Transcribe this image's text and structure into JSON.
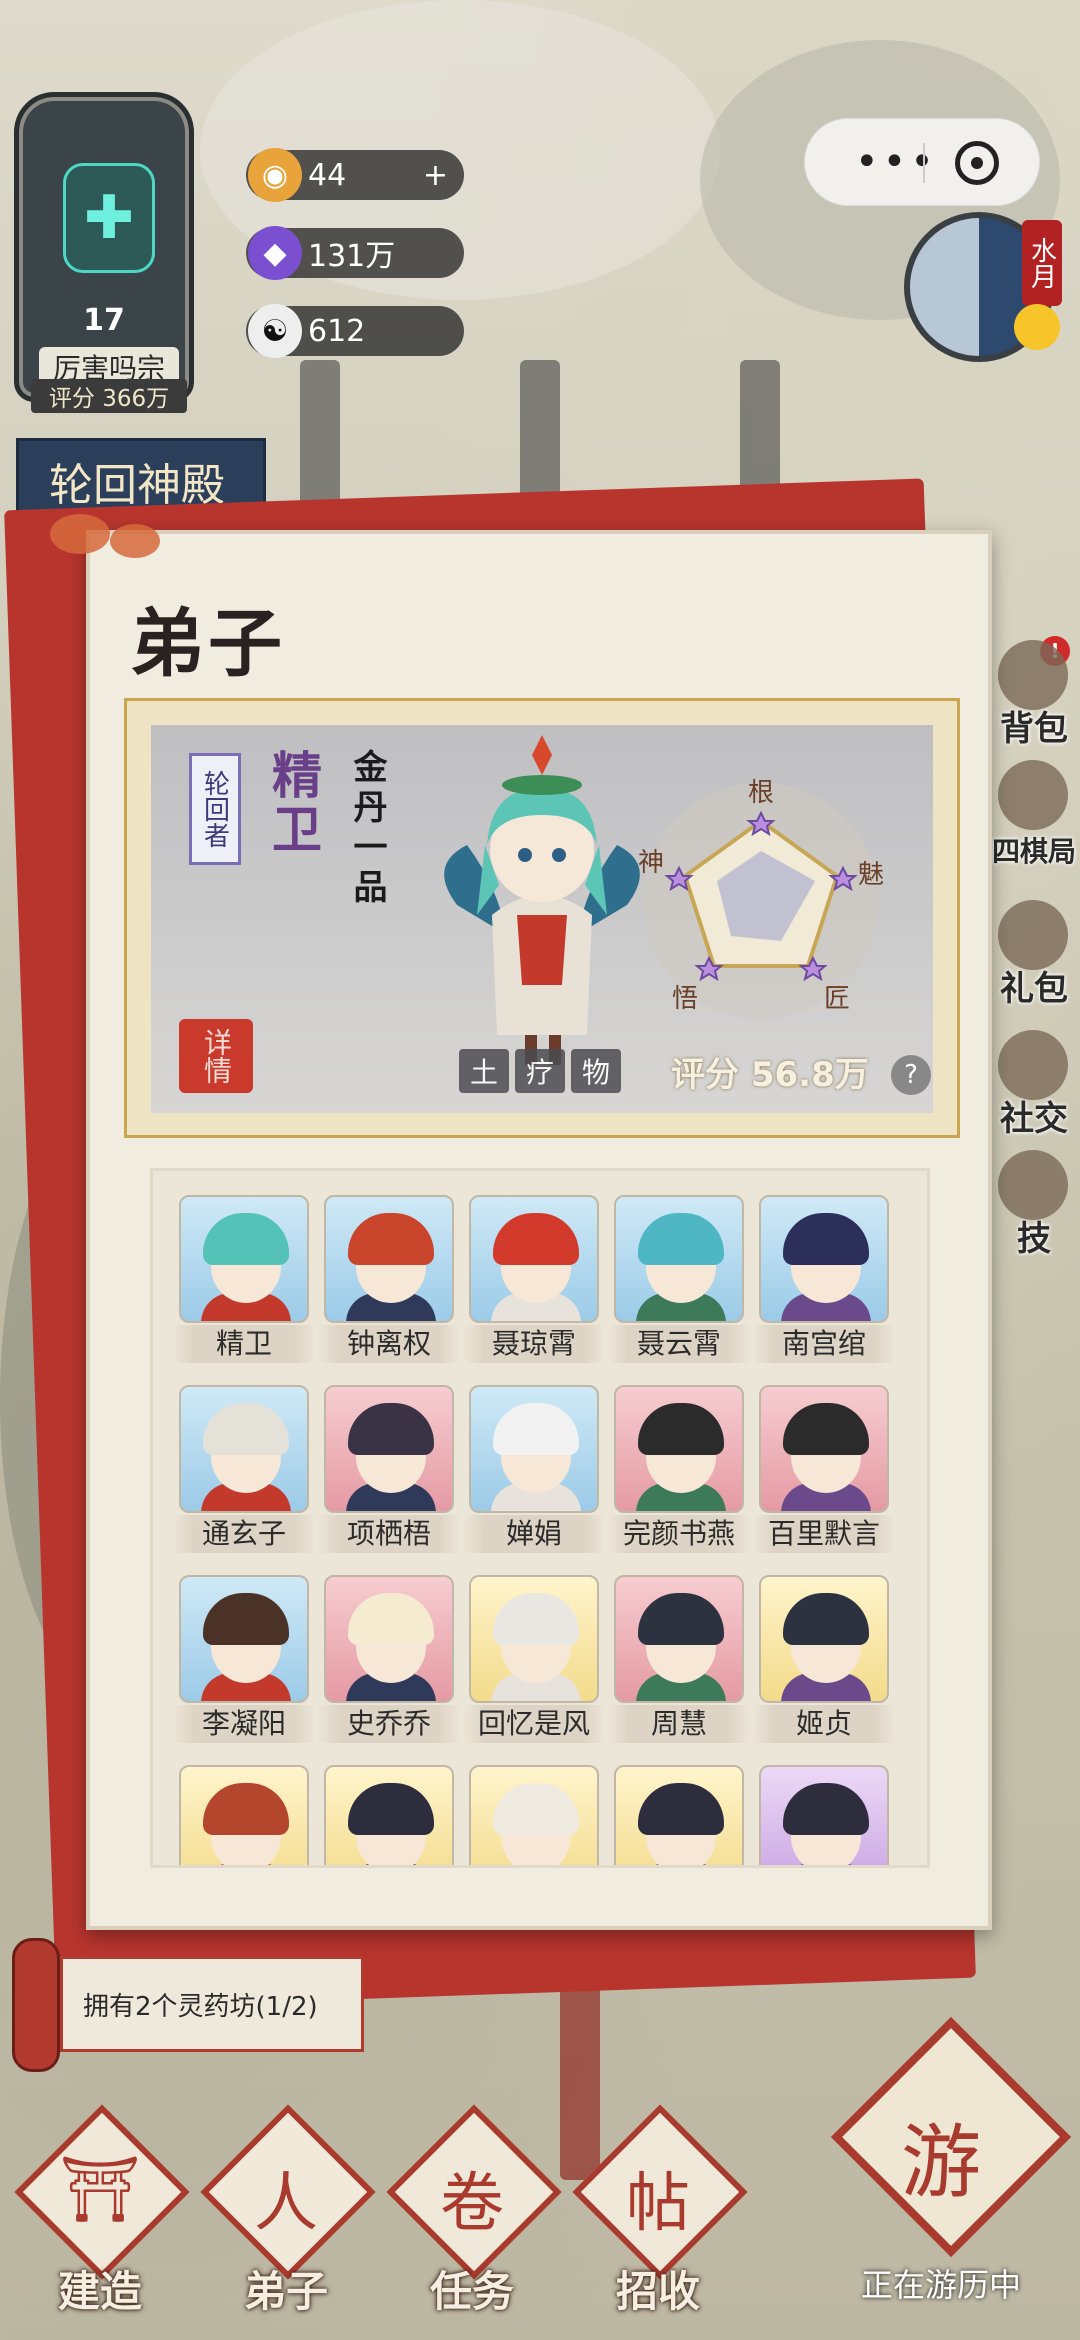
{
  "sect": {
    "level": "17",
    "name": "厉害吗宗",
    "score": "评分 366万"
  },
  "resources": [
    {
      "icon": "spirit-stone-icon",
      "value": "44",
      "plus": "+"
    },
    {
      "icon": "crystal-icon",
      "value": "131万"
    },
    {
      "icon": "yin-yang-icon",
      "value": "612"
    }
  ],
  "left_building_label": "轮回神殿",
  "side_menu": [
    "背包",
    "四棋局",
    "礼包",
    "社交",
    "技"
  ],
  "dial_tag": "水月",
  "panel": {
    "title": "弟子",
    "hero": {
      "badge": "轮回者",
      "name": "精卫",
      "rank": "金丹一品",
      "detail_label": "详情",
      "element_tags": [
        "土",
        "疗",
        "物"
      ],
      "score": "评分 56.8万",
      "help": "?"
    },
    "radar_labels": [
      "根",
      "魅",
      "匠",
      "悟",
      "神"
    ],
    "disciples": [
      {
        "name": "精卫",
        "bg": "blue",
        "hair": "#54c2b6"
      },
      {
        "name": "钟离权",
        "bg": "blue",
        "hair": "#c9452c"
      },
      {
        "name": "聂琼霄",
        "bg": "blue",
        "hair": "#d23a2c"
      },
      {
        "name": "聂云霄",
        "bg": "blue",
        "hair": "#4fb7c4"
      },
      {
        "name": "南宫绾",
        "bg": "blue",
        "hair": "#2b2f5a"
      },
      {
        "name": "通玄子",
        "bg": "blue",
        "hair": "#e4e2d8"
      },
      {
        "name": "项栖梧",
        "bg": "pink",
        "hair": "#3a3346"
      },
      {
        "name": "婵娟",
        "bg": "blue",
        "hair": "#f2f2f2"
      },
      {
        "name": "完颜书燕",
        "bg": "pink",
        "hair": "#2b2b2b"
      },
      {
        "name": "百里默言",
        "bg": "pink",
        "hair": "#2b2b2b"
      },
      {
        "name": "李凝阳",
        "bg": "blue",
        "hair": "#4a3226"
      },
      {
        "name": "史乔乔",
        "bg": "pink",
        "hair": "#f4ebd0"
      },
      {
        "name": "回忆是风",
        "bg": "yellow",
        "hair": "#e9e7e2"
      },
      {
        "name": "周慧",
        "bg": "pink",
        "hair": "#2d3240"
      },
      {
        "name": "姬贞",
        "bg": "yellow",
        "hair": "#2d3240"
      },
      {
        "name": "",
        "bg": "yellow",
        "hair": "#b5462e"
      },
      {
        "name": "",
        "bg": "yellow",
        "hair": "#2d2d3e"
      },
      {
        "name": "",
        "bg": "yellow",
        "hair": "#efeae0"
      },
      {
        "name": "",
        "bg": "yellow",
        "hair": "#2d2d3e"
      },
      {
        "name": "",
        "bg": "purple",
        "hair": "#2d2d3e"
      }
    ]
  },
  "quest": {
    "text": "拥有2个灵药坊(1/2)"
  },
  "bottom_nav": [
    {
      "label": "建造",
      "glyph": "⛩",
      "icon": "build-icon"
    },
    {
      "label": "弟子",
      "glyph": "人",
      "icon": "disciple-icon"
    },
    {
      "label": "任务",
      "glyph": "卷",
      "icon": "task-icon"
    },
    {
      "label": "招收",
      "glyph": "帖",
      "icon": "recruit-icon"
    }
  ],
  "travel": {
    "label": "正在游历中",
    "glyph": "游"
  },
  "colors": {
    "accent_red": "#a93a2e",
    "panel_bg": "#f1ece0",
    "gold": "#c9a64f"
  }
}
